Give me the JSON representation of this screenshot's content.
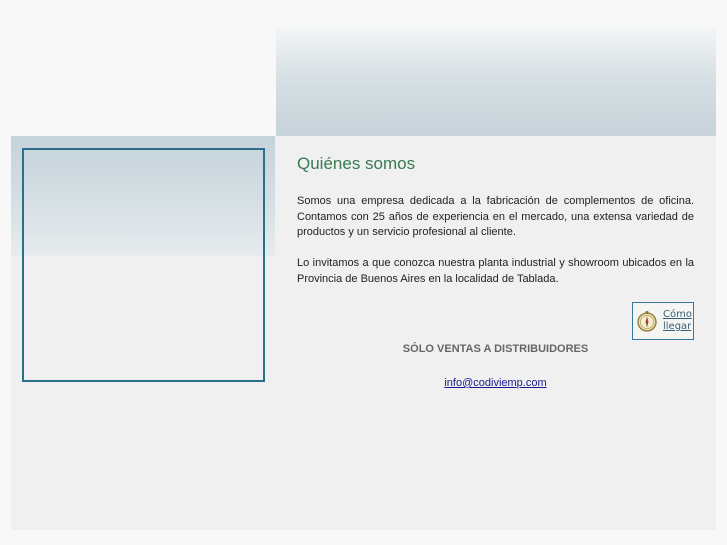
{
  "about": {
    "title": "Quiénes somos",
    "paragraph_1": "Somos una empresa dedicada a la fabricación de complementos de oficina. Contamos con 25 años de experiencia en el mercado, una extensa variedad de productos y un servicio profesional al cliente.",
    "paragraph_2": "Lo invitamos a que conozca nuestra planta industrial y showroom ubicados en la Provincia de Buenos Aires en la localidad de Tablada."
  },
  "directions_button": {
    "line_1": "Cómo",
    "line_2": "llegar",
    "icon": "compass-icon"
  },
  "sales_notice": "SÓLO VENTAS A DISTRIBUIDORES",
  "contact": {
    "email": "info@codiviemp.com"
  },
  "colors": {
    "title": "#3a7a52",
    "frame_border": "#2b6f8c",
    "link": "#1a1a8c"
  }
}
